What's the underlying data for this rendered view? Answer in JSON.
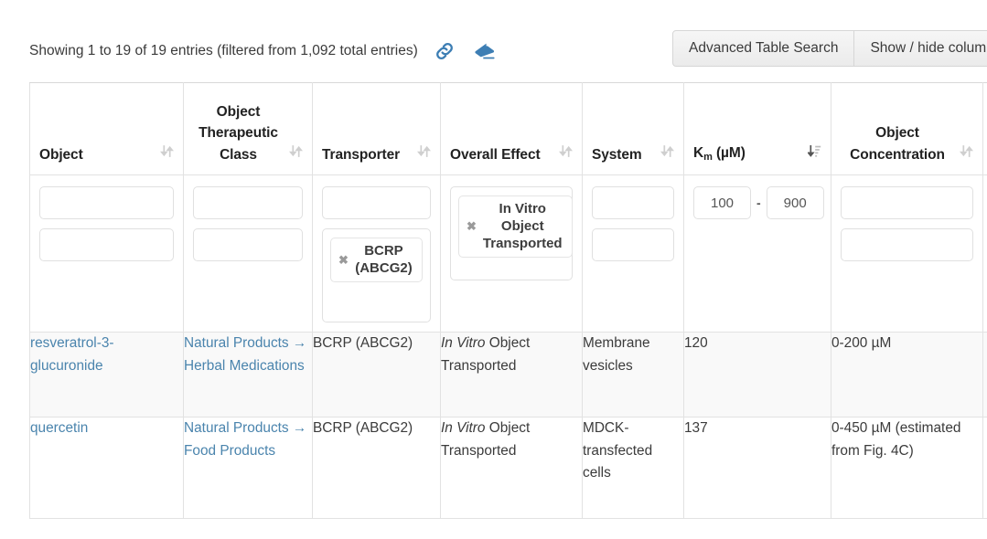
{
  "toolbar": {
    "info_text": "Showing 1 to 19 of 19 entries (filtered from 1,092 total entries)",
    "link_icon": "link-icon",
    "eraser_icon": "eraser-icon",
    "buttons": [
      {
        "label": "Advanced Table Search"
      },
      {
        "label": "Show / hide columns"
      }
    ]
  },
  "accent_colors": {
    "icon_blue": "#3d7eb4",
    "link_blue": "#4a84ad",
    "header_text": "#222222",
    "row_alt_bg": "#f9f9f9",
    "border": "#e2e2e2"
  },
  "table": {
    "columns": [
      {
        "label": "Object",
        "sort": "inactive",
        "sort_icon": "sort-both-icon"
      },
      {
        "label": "Object Therapeutic Class",
        "sort": "inactive",
        "sort_icon": "sort-both-icon"
      },
      {
        "label": "Transporter",
        "sort": "inactive",
        "sort_icon": "sort-both-icon"
      },
      {
        "label": "Overall Effect",
        "sort": "inactive",
        "sort_icon": "sort-both-icon"
      },
      {
        "label": "System",
        "sort": "inactive",
        "sort_icon": "sort-both-icon"
      },
      {
        "label": "Km (µM)",
        "sort": "active",
        "sort_icon": "sort-amount-down-icon",
        "label_main": "K",
        "label_sub": "m",
        "label_rest": " (µM)"
      },
      {
        "label": "Object Concentration",
        "sort": "inactive",
        "sort_icon": "sort-both-icon"
      }
    ],
    "filters": {
      "object": {
        "inputs": [
          "",
          ""
        ]
      },
      "therapeutic": {
        "inputs": [
          "",
          ""
        ]
      },
      "transporter": {
        "inputs": [
          ""
        ],
        "tags": [
          "BCRP (ABCG2)"
        ]
      },
      "overall_effect": {
        "tags": [
          "In Vitro Object Transported"
        ]
      },
      "system": {
        "inputs": [
          "",
          ""
        ]
      },
      "km": {
        "min": "100",
        "max": "900",
        "separator": "-"
      },
      "concentration": {
        "inputs": [
          "",
          ""
        ]
      }
    },
    "rows": [
      {
        "object": "resveratrol-3-glucuronide",
        "therapeutic_class": "Natural Products → Herbal Medications",
        "transporter": "BCRP (ABCG2)",
        "overall_effect_italic": "In Vitro",
        "overall_effect_rest": " Object Transported",
        "system": "Membrane vesicles",
        "km": "120",
        "concentration": "0-200 µM"
      },
      {
        "object": "quercetin",
        "therapeutic_class": "Natural Products → Food Products",
        "transporter": "BCRP (ABCG2)",
        "overall_effect_italic": "In Vitro",
        "overall_effect_rest": " Object Transported",
        "system": "MDCK-transfected cells",
        "km": "137",
        "concentration": "0-450 µM (estimated from Fig. 4C)"
      }
    ]
  }
}
